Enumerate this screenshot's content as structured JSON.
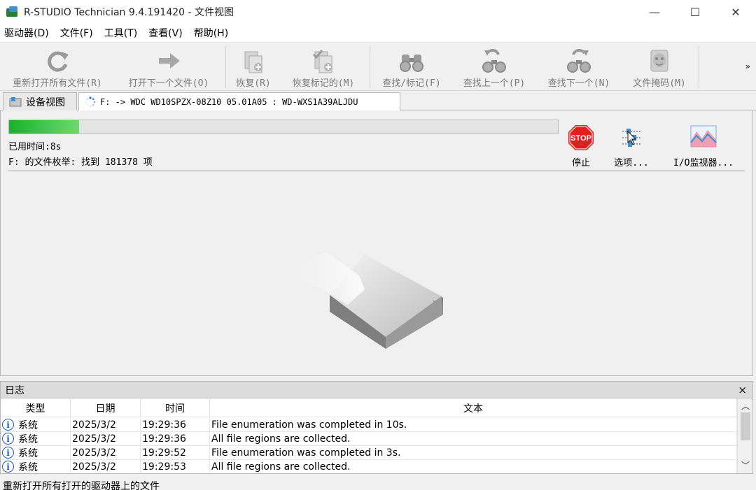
{
  "window": {
    "title": "R-STUDIO Technician 9.4.191420 - 文件视图",
    "minimize": "—",
    "maximize": "☐",
    "close": "✕"
  },
  "menu": [
    "驱动器(D)",
    "文件(F)",
    "工具(T)",
    "查看(V)",
    "帮助(H)"
  ],
  "toolbar": {
    "buttons": [
      {
        "label": "重新打开所有文件(R)",
        "icon": "refresh-icon"
      },
      {
        "label": "打开下一个文件(O)",
        "icon": "arrow-right-icon"
      },
      {
        "label": "恢复(R)",
        "icon": "recover-icon"
      },
      {
        "label": "恢复标记的(M)",
        "icon": "recover-marked-icon"
      },
      {
        "label": "查找/标记(F)",
        "icon": "binoculars-icon"
      },
      {
        "label": "查找上一个(P)",
        "icon": "find-previous-icon"
      },
      {
        "label": "查找下一个(N)",
        "icon": "find-next-icon"
      },
      {
        "label": "文件掩码(M)",
        "icon": "file-mask-icon"
      }
    ],
    "more": "»"
  },
  "tabs": [
    {
      "label": "设备视图",
      "icon": "device-view-icon"
    },
    {
      "label": "F: -> WDC WD10SPZX-08Z10 05.01A05 : WD-WXS1A39ALJDU",
      "icon": "spinner-icon"
    }
  ],
  "progress": {
    "fraction": 0.127,
    "elapsed": "已用时间:8s",
    "status": "F: 的文件枚举: 找到 181378 项"
  },
  "actions": [
    {
      "label": "停止",
      "icon": "stop-icon"
    },
    {
      "label": "选项...",
      "icon": "options-icon"
    },
    {
      "label": "I/O监视器...",
      "icon": "io-monitor-icon"
    }
  ],
  "stop_sign_text": "STOP",
  "log": {
    "title": "日志",
    "close": "×",
    "columns": [
      "类型",
      "日期",
      "时间",
      "文本"
    ],
    "rows": [
      {
        "type": "系统",
        "date": "2025/3/2",
        "time": "19:29:36",
        "text": "File enumeration was completed in 10s."
      },
      {
        "type": "系统",
        "date": "2025/3/2",
        "time": "19:29:36",
        "text": "All file regions are collected."
      },
      {
        "type": "系统",
        "date": "2025/3/2",
        "time": "19:29:52",
        "text": "File enumeration was completed in 3s."
      },
      {
        "type": "系统",
        "date": "2025/3/2",
        "time": "19:29:53",
        "text": "All file regions are collected."
      }
    ]
  },
  "statusbar": "重新打开所有打开的驱动器上的文件"
}
